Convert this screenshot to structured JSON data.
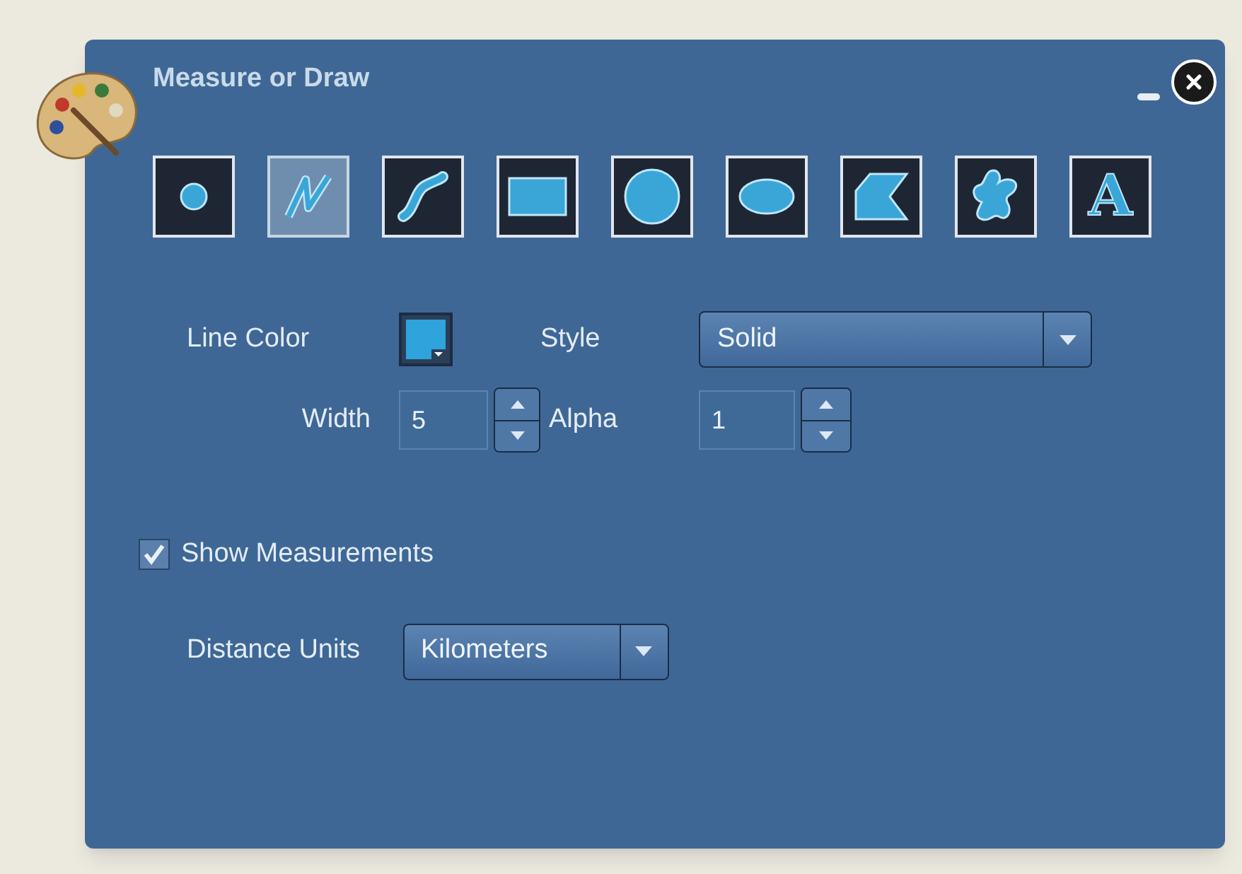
{
  "window": {
    "title": "Measure or Draw"
  },
  "tools": [
    {
      "kind": "point",
      "selected": false
    },
    {
      "kind": "polyline",
      "selected": true
    },
    {
      "kind": "freehand",
      "selected": false
    },
    {
      "kind": "rectangle",
      "selected": false
    },
    {
      "kind": "circle",
      "selected": false
    },
    {
      "kind": "ellipse",
      "selected": false
    },
    {
      "kind": "polygon",
      "selected": false
    },
    {
      "kind": "freeshape",
      "selected": false
    },
    {
      "kind": "text",
      "selected": false,
      "glyph": "A"
    }
  ],
  "line_color": {
    "label": "Line Color",
    "color": "#2ea3dc"
  },
  "style": {
    "label": "Style",
    "value": "Solid"
  },
  "width": {
    "label": "Width",
    "value": "5"
  },
  "alpha": {
    "label": "Alpha",
    "value": "1"
  },
  "show_measurements": {
    "label": "Show Measurements",
    "checked": true
  },
  "distance_units": {
    "label": "Distance Units",
    "value": "Kilometers"
  }
}
